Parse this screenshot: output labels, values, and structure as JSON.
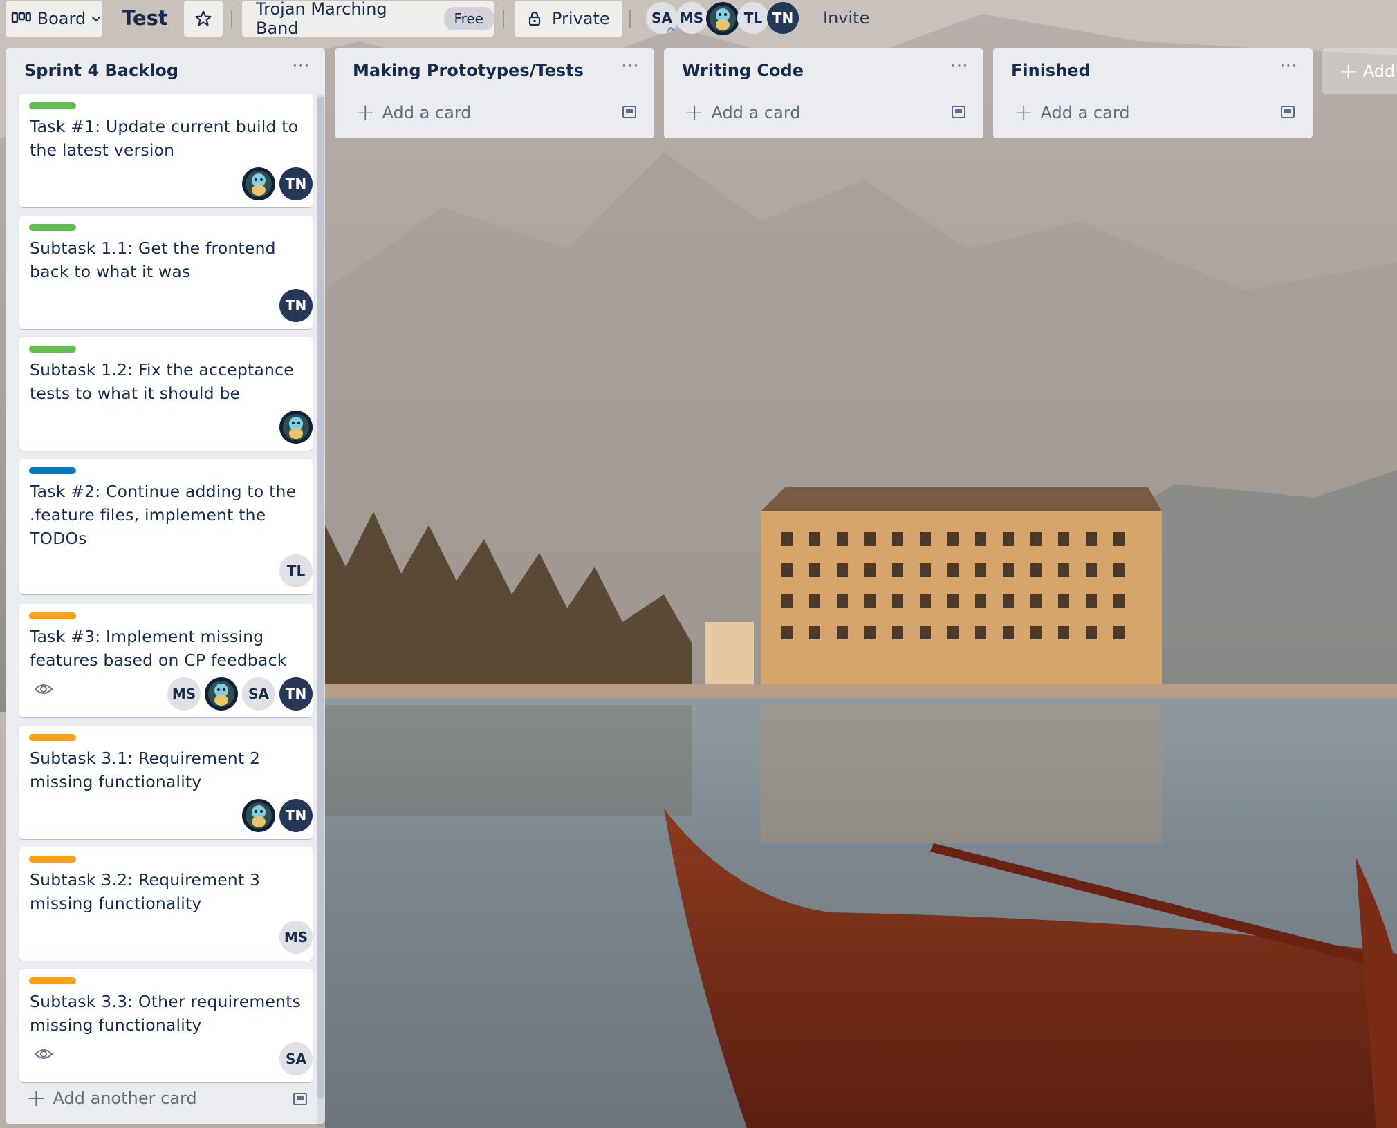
{
  "header": {
    "board_menu_label": "Board",
    "board_title": "Test",
    "team_name": "Trojan Marching Band",
    "team_plan_badge": "Free",
    "visibility_label": "Private",
    "members": [
      "SA",
      "MS",
      "TL",
      "TN"
    ],
    "invite_label": "Invite",
    "add_list_label": "Add"
  },
  "lists": [
    {
      "title": "Sprint 4 Backlog",
      "add_label": "Add another card",
      "cards": [
        {
          "title": "Task #1: Update current build to the latest version",
          "label_color": "#61bd4f",
          "members": [
            "pic",
            "TN"
          ]
        },
        {
          "title": "Subtask 1.1: Get the frontend back to what it was",
          "label_color": "#61bd4f",
          "members": [
            "TN"
          ]
        },
        {
          "title": "Subtask 1.2: Fix the acceptance tests to what it should be",
          "label_color": "#61bd4f",
          "members": [
            "pic"
          ]
        },
        {
          "title": "Task #2: Continue adding to the .feature files, implement the TODOs",
          "label_color": "#0079bf",
          "members": [
            "TL"
          ]
        },
        {
          "title": "Task #3: Implement missing features based on CP feedback",
          "label_color": "#ff9f1a",
          "members": [
            "MS",
            "pic",
            "SA",
            "TN"
          ]
        },
        {
          "title": "Subtask 3.1: Requirement 2 missing functionality",
          "label_color": "#ff9f1a",
          "members": [
            "pic",
            "TN"
          ]
        },
        {
          "title": "Subtask 3.2: Requirement 3 missing functionality",
          "label_color": "#ff9f1a",
          "members": [
            "MS"
          ]
        },
        {
          "title": "Subtask 3.3: Other requirements missing functionality",
          "label_color": "#ff9f1a",
          "members": [
            "SA"
          ]
        }
      ]
    },
    {
      "title": "Making Prototypes/Tests",
      "add_label": "Add a card",
      "cards": []
    },
    {
      "title": "Writing Code",
      "add_label": "Add a card",
      "cards": []
    },
    {
      "title": "Finished",
      "add_label": "Add a card",
      "cards": []
    }
  ]
}
